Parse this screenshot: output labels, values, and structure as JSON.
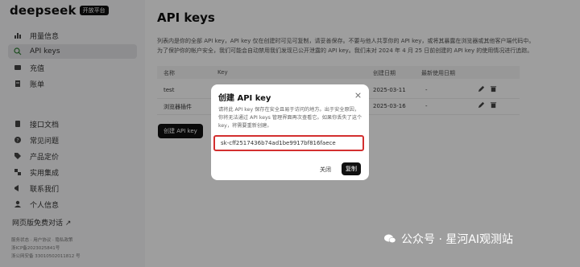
{
  "app": {
    "name": "deepseek",
    "badge": "开放平台"
  },
  "sidebar": {
    "items": [
      {
        "label": "用量信息",
        "icon": "usage-chart-icon"
      },
      {
        "label": "API keys",
        "icon": "search-key-icon",
        "active": true
      },
      {
        "label": "充值",
        "icon": "wallet-icon"
      },
      {
        "label": "账单",
        "icon": "bill-icon"
      },
      {
        "label": "接口文档",
        "icon": "document-icon"
      },
      {
        "label": "常见问题",
        "icon": "question-icon"
      },
      {
        "label": "产品定价",
        "icon": "price-tag-icon"
      },
      {
        "label": "实用集成",
        "icon": "integration-icon"
      },
      {
        "label": "联系我们",
        "icon": "megaphone-icon"
      },
      {
        "label": "个人信息",
        "icon": "user-icon"
      }
    ],
    "free_chat": "网页版免费对话 ↗",
    "footer": [
      "服务状态 · 用户协议 · 隐私政策",
      "浙ICP备2023025841号",
      "浙公网安备 33010502011812 号"
    ]
  },
  "main": {
    "title": "API keys",
    "description": "列表内是你的全部 API key，API key 仅在创建时可见可复制，请妥善保存。不要与他人共享你的 API key，或将其暴露在浏览器或其他客户端代码中。为了保护你的帐户安全，我们可能会自动禁用我们发现已公开泄露的 API key。我们未对 2024 年 4 月 25 日前创建的 API key 的使用情况进行追踪。",
    "columns": [
      "名称",
      "Key",
      "创建日期",
      "最新使用日期"
    ],
    "rows": [
      {
        "name": "test",
        "created": "2025-03-11",
        "last_used": "-"
      },
      {
        "name": "浏览器插件",
        "created": "2025-03-16",
        "last_used": "-"
      }
    ],
    "create_button": "创建 API key"
  },
  "modal": {
    "title": "创建 API key",
    "description": "请将此 API key 保存在安全且易于访问的地方。出于安全原因，你将无法通过 API keys 管理界面再次查看它。如果你丢失了这个 key，将需要重新创建。",
    "key_value": "sk-cff2517436b74ad1be9917bf816faece",
    "close_label": "关闭",
    "copy_label": "复制"
  },
  "watermark": "公众号 · 星河AI观测站",
  "colors": {
    "highlight": "#d32f2f",
    "primary": "#111111"
  }
}
